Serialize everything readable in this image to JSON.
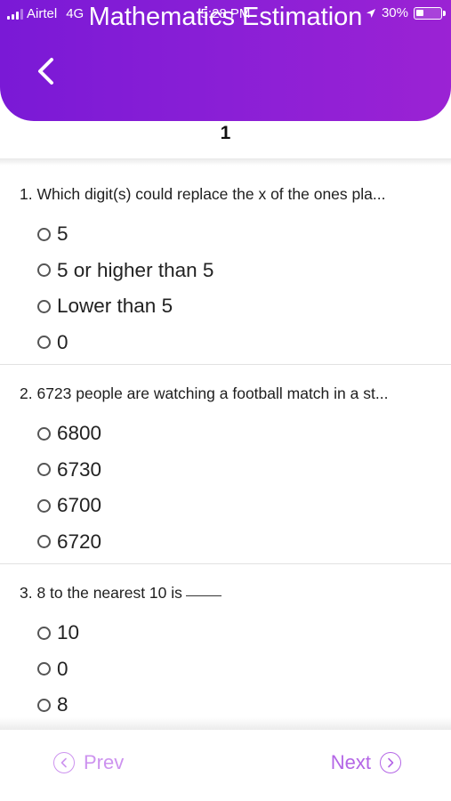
{
  "status_bar": {
    "carrier": "Airtel",
    "network": "4G",
    "time": "5:28 PM",
    "battery": "30%",
    "battery_level": 0.3
  },
  "header": {
    "title": "Mathematics Estimation",
    "back_icon": "chevron-left-icon",
    "color_start": "#7a19d6",
    "color_end": "#9b22d4"
  },
  "page_number": "1",
  "questions": [
    {
      "text": "1. Which digit(s) could replace the x of the ones pla...",
      "options": [
        "5",
        "5 or higher than 5",
        "Lower than 5",
        "0"
      ]
    },
    {
      "text": "2. 6723 people are watching a football match in a st...",
      "options": [
        "6800",
        "6730",
        "6700",
        "6720"
      ]
    },
    {
      "text": "3. 8 to the nearest 10 is",
      "options": [
        "10",
        "0",
        "8"
      ]
    }
  ],
  "footer": {
    "prev_label": "Prev",
    "next_label": "Next",
    "prev_icon": "chevron-left-circle-icon",
    "next_icon": "chevron-right-circle-icon",
    "accent": "#b466e6"
  }
}
